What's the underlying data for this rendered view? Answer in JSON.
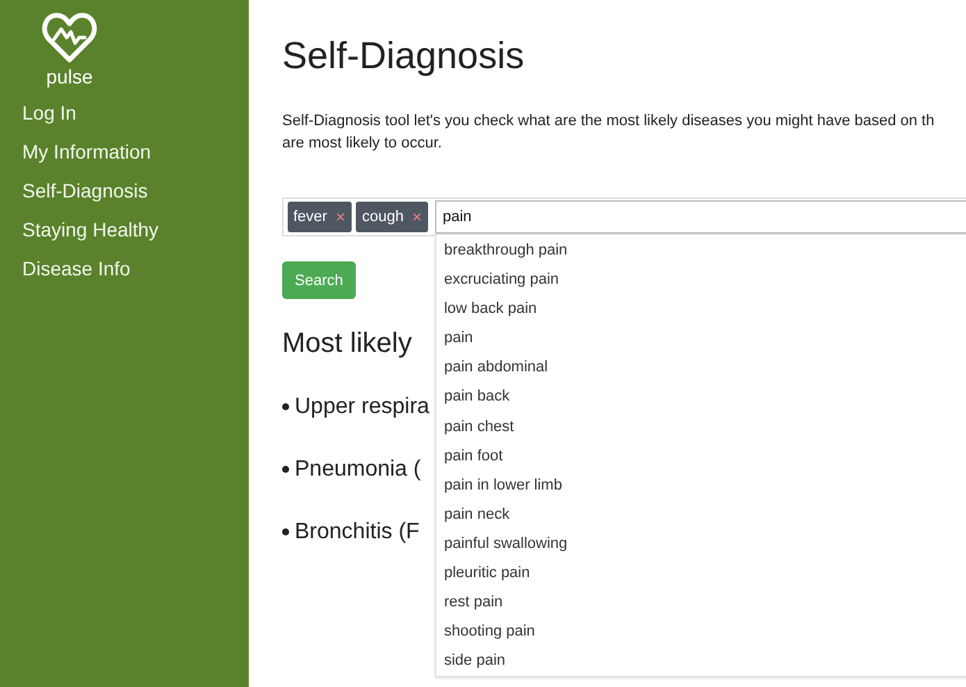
{
  "sidebar": {
    "logo_text": "pulse",
    "items": [
      {
        "label": "Log In",
        "selected": false
      },
      {
        "label": "My Information",
        "selected": false
      },
      {
        "label": "Self-Diagnosis",
        "selected": false
      },
      {
        "label": "Staying Healthy",
        "selected": false
      },
      {
        "label": "Disease Info",
        "selected": false
      }
    ]
  },
  "main": {
    "title": "Self-Diagnosis",
    "description_lines": [
      "Self-Diagnosis tool let's you check what are the most likely diseases you might have based on th",
      "are most likely to occur."
    ],
    "symptoms": [
      {
        "label": "fever",
        "remove": "×"
      },
      {
        "label": "cough",
        "remove": "×"
      }
    ],
    "symptom_input": {
      "value": "pain"
    },
    "suggestions": [
      "breakthrough pain",
      "excruciating pain",
      "low back pain",
      "pain",
      "pain abdominal",
      "pain back",
      "pain chest",
      "pain foot",
      "pain in lower limb",
      "pain neck",
      "painful swallowing",
      "pleuritic pain",
      "rest pain",
      "shooting pain",
      "side pain"
    ],
    "search_button": "Search",
    "results_heading": "Most likely",
    "results": [
      "Upper respira",
      "Pneumonia (",
      "Bronchitis (F"
    ]
  }
}
